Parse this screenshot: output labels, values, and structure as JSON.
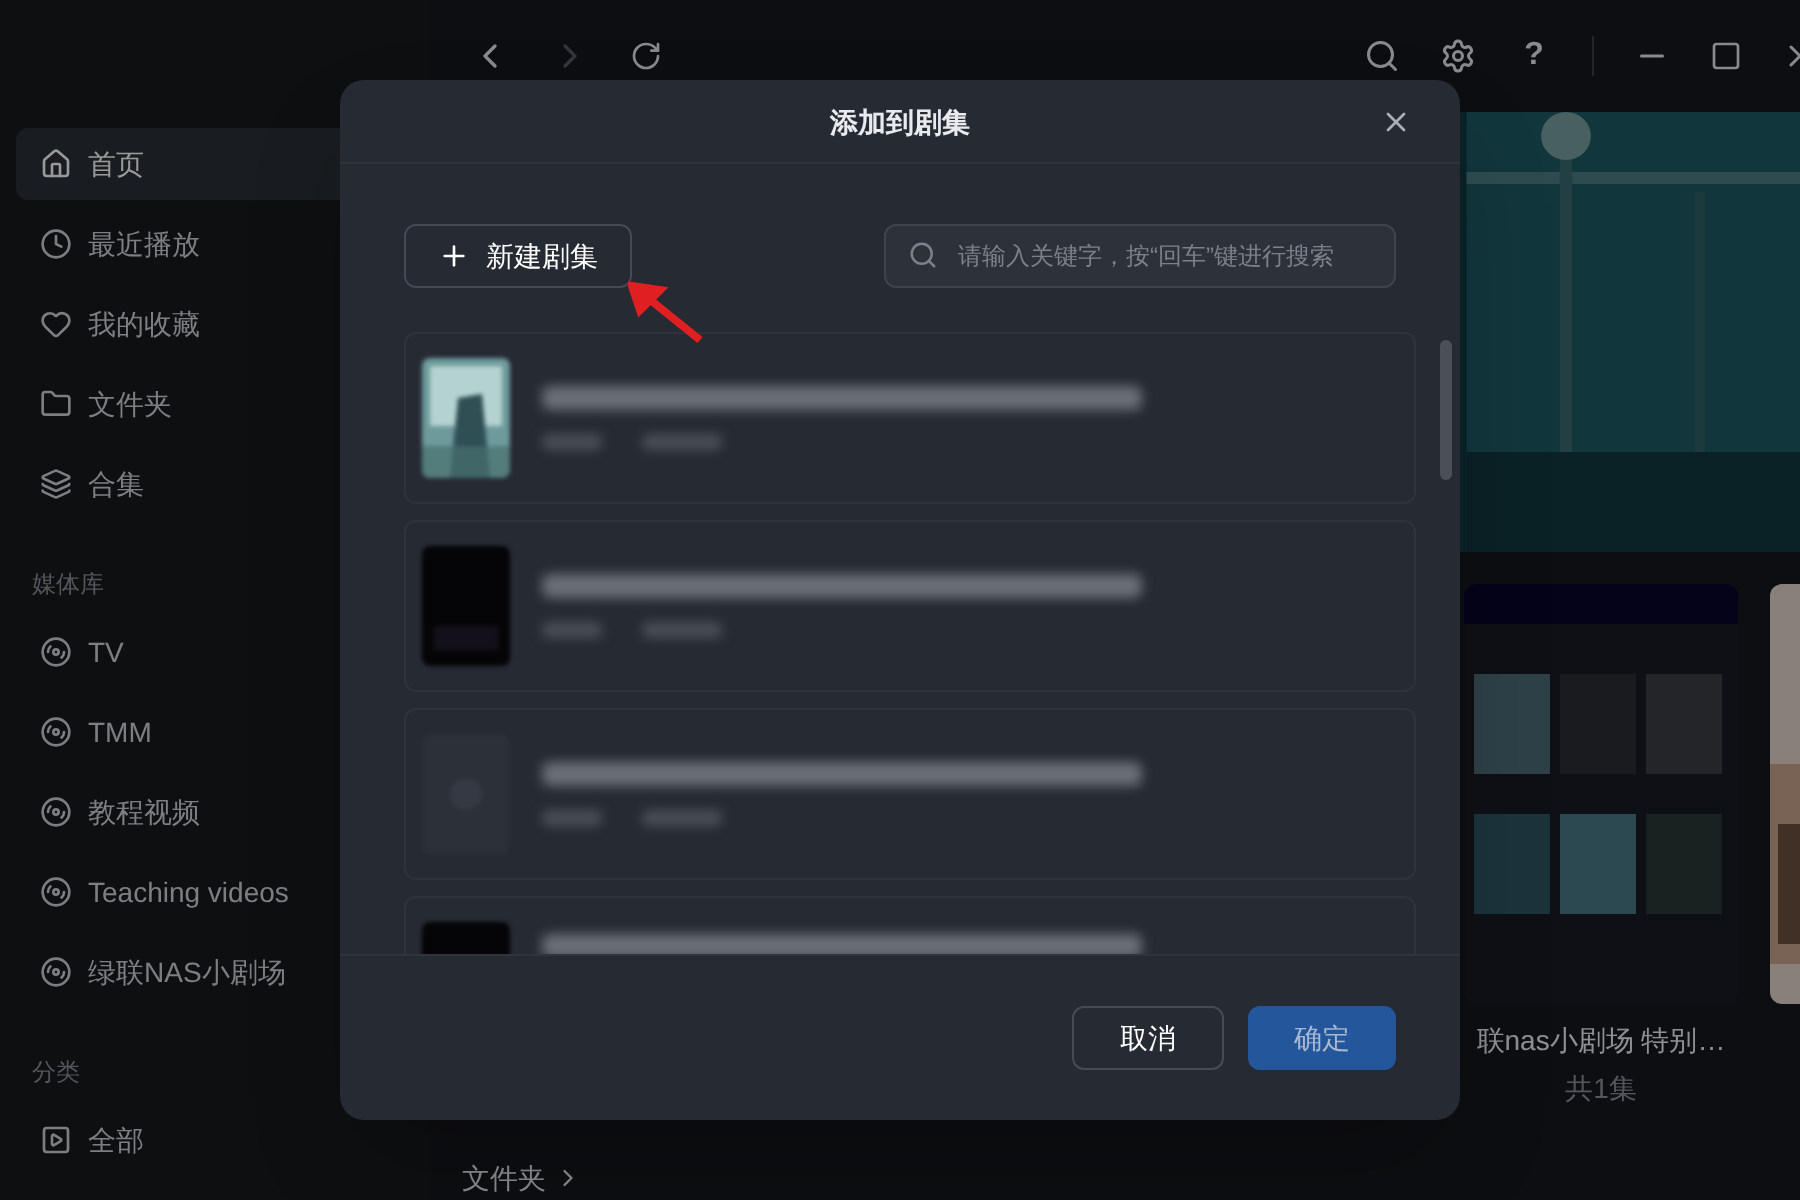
{
  "top_bar": {
    "help": "?"
  },
  "sidebar": {
    "items": [
      {
        "label": "首页",
        "selected": true
      },
      {
        "label": "最近播放",
        "selected": false
      },
      {
        "label": "我的收藏",
        "selected": false
      },
      {
        "label": "文件夹",
        "selected": false
      },
      {
        "label": "合集",
        "selected": false
      }
    ],
    "sections": [
      {
        "title": "媒体库",
        "items": [
          {
            "label": "TV",
            "selected": false
          },
          {
            "label": "TMM",
            "selected": false
          },
          {
            "label": "教程视频",
            "selected": false
          },
          {
            "label": "Teaching videos",
            "selected": false
          },
          {
            "label": "绿联NAS小剧场",
            "selected": false
          }
        ]
      },
      {
        "title": "分类",
        "items": [
          {
            "label": "全部",
            "selected": false
          }
        ]
      }
    ]
  },
  "main": {
    "card": {
      "title": "联nas小剧场 特别…",
      "subtitle": "共1集"
    },
    "folder_heading": "文件夹"
  },
  "dialog": {
    "title": "添加到剧集",
    "new_button": "新建剧集",
    "search": {
      "placeholder": "请输入关键字，按“回车”键进行搜索"
    },
    "rows": [
      {
        "kind": "picture",
        "meta": true
      },
      {
        "kind": "dark",
        "meta": true
      },
      {
        "kind": "faded",
        "meta": true
      },
      {
        "kind": "dark",
        "meta": false
      }
    ],
    "cancel": "取消",
    "confirm": "确定"
  }
}
